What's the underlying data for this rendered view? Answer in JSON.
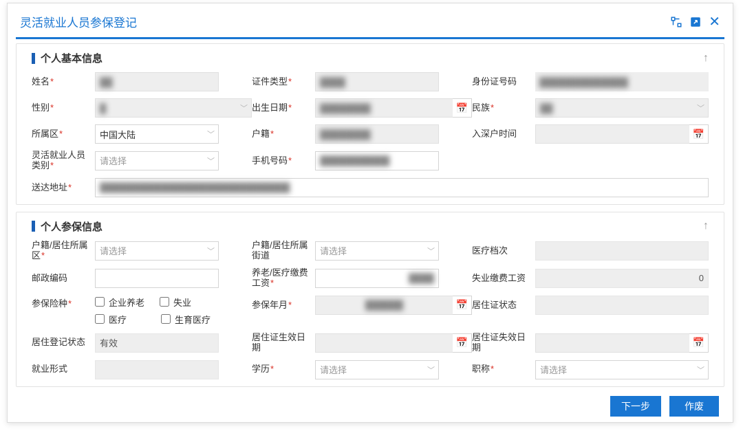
{
  "header": {
    "title": "灵活就业人员参保登记"
  },
  "panels": {
    "basic": {
      "title": "个人基本信息",
      "fields": {
        "name_label": "姓名",
        "id_type_label": "证件类型",
        "id_no_label": "身份证号码",
        "gender_label": "性别",
        "birth_label": "出生日期",
        "ethnic_label": "民族",
        "region_label": "所属区",
        "region_value": "中国大陆",
        "huji_label": "户籍",
        "enter_sz_label": "入深户时间",
        "flex_type_label": "灵活就业人员类别",
        "flex_type_placeholder": "请选择",
        "phone_label": "手机号码",
        "addr_label": "送达地址"
      }
    },
    "insure": {
      "title": "个人参保信息",
      "fields": {
        "huji_district_label": "户籍/居住所属区",
        "huji_district_placeholder": "请选择",
        "huji_street_label": "户籍/居住所属街道",
        "huji_street_placeholder": "请选择",
        "medical_level_label": "医疗档次",
        "postcode_label": "邮政编码",
        "pension_wage_label": "养老/医疗缴费工资",
        "unemp_wage_label": "失业缴费工资",
        "unemp_wage_value": "0",
        "ins_types_label": "参保险种",
        "ins_opt_pension": "企业养老",
        "ins_opt_unemp": "失业",
        "ins_opt_medical": "医疗",
        "ins_opt_maternity": "生育医疗",
        "ins_month_label": "参保年月",
        "permit_status_label": "居住证状态",
        "reg_status_label": "居住登记状态",
        "reg_status_value": "有效",
        "permit_start_label": "居住证生效日期",
        "permit_end_label": "居住证失效日期",
        "job_form_label": "就业形式",
        "edu_label": "学历",
        "edu_placeholder": "请选择",
        "title_label": "职称",
        "title_placeholder": "请选择"
      }
    }
  },
  "footer": {
    "next": "下一步",
    "void": "作废"
  }
}
